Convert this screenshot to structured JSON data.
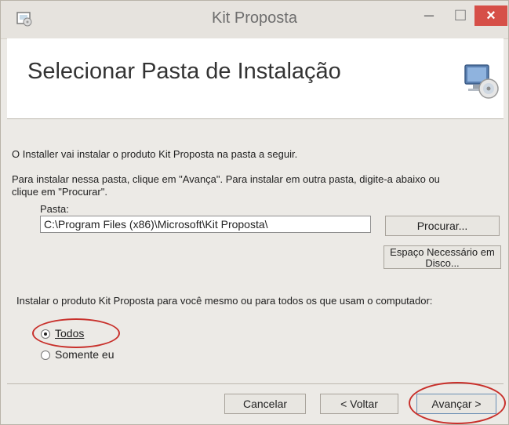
{
  "window": {
    "title": "Kit Proposta",
    "minimize_glyph": "–",
    "maximize_glyph": "□",
    "close_glyph": "×"
  },
  "header": {
    "heading": "Selecionar Pasta de Instalação",
    "icon": "installer-computer-cd-icon"
  },
  "body": {
    "intro_text": "O Installer vai instalar o produto Kit Proposta na pasta a seguir.",
    "instructions_line1": "Para instalar nessa pasta, clique em \"Avança\". Para instalar em outra pasta, digite-a abaixo ou",
    "instructions_line2": "clique em \"Procurar\".",
    "folder_label": "Pasta:",
    "folder_value": "C:\\Program Files (x86)\\Microsoft\\Kit Proposta\\",
    "browse_label": "Procurar...",
    "disk_space_line1": "Espaço Necessário em",
    "disk_space_line2": "Disco...",
    "install_for_text": "Instalar o produto Kit Proposta para você mesmo ou para todos os que usam o computador:",
    "option_all": "Todos",
    "option_me": "Somente eu",
    "selected_option": "Todos"
  },
  "footer": {
    "cancel_label": "Cancelar",
    "back_label": "< Voltar",
    "next_label": "Avançar >"
  },
  "colors": {
    "close_button": "#d64f48",
    "annotation": "#c8302b"
  }
}
